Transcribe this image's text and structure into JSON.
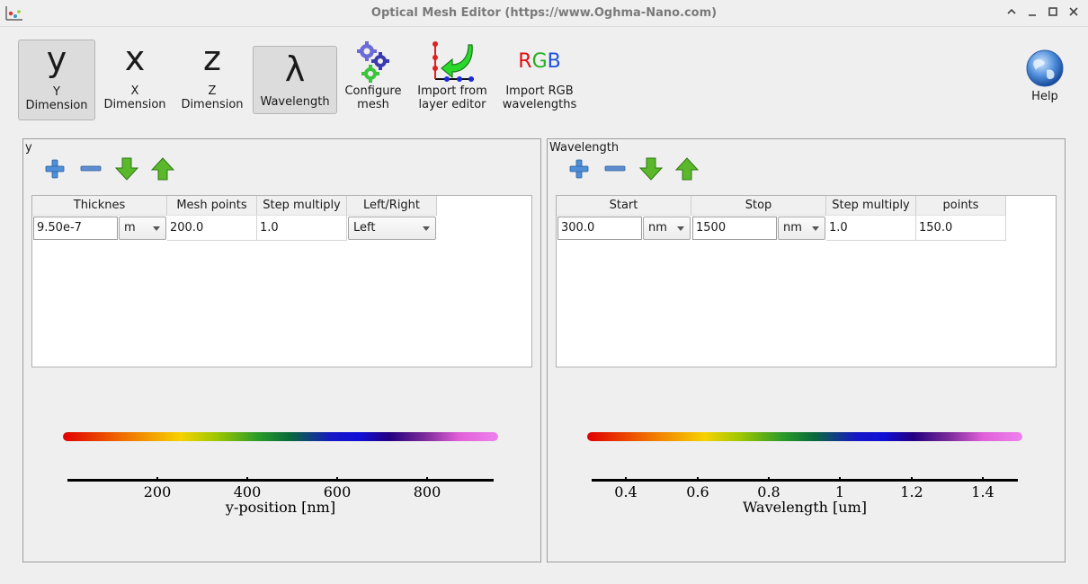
{
  "window": {
    "title": "Optical Mesh Editor (https://www.Oghma-Nano.com)",
    "controls": {
      "minimize": "—",
      "maximize": "☐",
      "close": "✕",
      "restore": "︿"
    }
  },
  "toolbar": {
    "y_dimension": {
      "glyph": "y",
      "label_line1": "Y",
      "label_line2": "Dimension"
    },
    "x_dimension": {
      "glyph": "x",
      "label_line1": "X",
      "label_line2": "Dimension"
    },
    "z_dimension": {
      "glyph": "z",
      "label_line1": "Z",
      "label_line2": "Dimension"
    },
    "wavelength": {
      "glyph": "λ",
      "label": "Wavelength"
    },
    "configure_mesh": {
      "label_line1": "Configure",
      "label_line2": "mesh",
      "icon": "gears-icon"
    },
    "import_layer": {
      "label_line1": "Import from",
      "label_line2": "layer editor",
      "icon": "import-arrow-icon"
    },
    "import_rgb": {
      "icon_r": "R",
      "icon_g": "G",
      "icon_b": "B",
      "label_line1": "Import RGB",
      "label_line2": "wavelengths"
    },
    "help": {
      "label": "Help",
      "icon": "globe-icon"
    }
  },
  "y_panel": {
    "title": "y",
    "headers": [
      "Thicknes",
      "Mesh points",
      "Step multiply",
      "Left/Right"
    ],
    "row": {
      "thickness": "9.50e-7",
      "unit": "m",
      "mesh_points": "200.0",
      "step_multiply": "1.0",
      "left_right": "Left"
    },
    "axis": {
      "ticks": [
        "200",
        "400",
        "600",
        "800"
      ],
      "title": "y-position [nm]"
    }
  },
  "wavelength_panel": {
    "title": "Wavelength",
    "headers": [
      "Start",
      "Stop",
      "Step multiply",
      "points"
    ],
    "row": {
      "start": "300.0",
      "start_unit": "nm",
      "stop": "1500",
      "stop_unit": "nm",
      "step_multiply": "1.0",
      "points": "150.0"
    },
    "axis": {
      "ticks": [
        "0.4",
        "0.6",
        "0.8",
        "1",
        "1.2",
        "1.4"
      ],
      "title": "Wavelength [um]"
    }
  },
  "colors": {
    "accent_green": "#4caf1a",
    "accent_blue": "#3a7fd0",
    "active_tool_bg": "#dcdcdc"
  }
}
